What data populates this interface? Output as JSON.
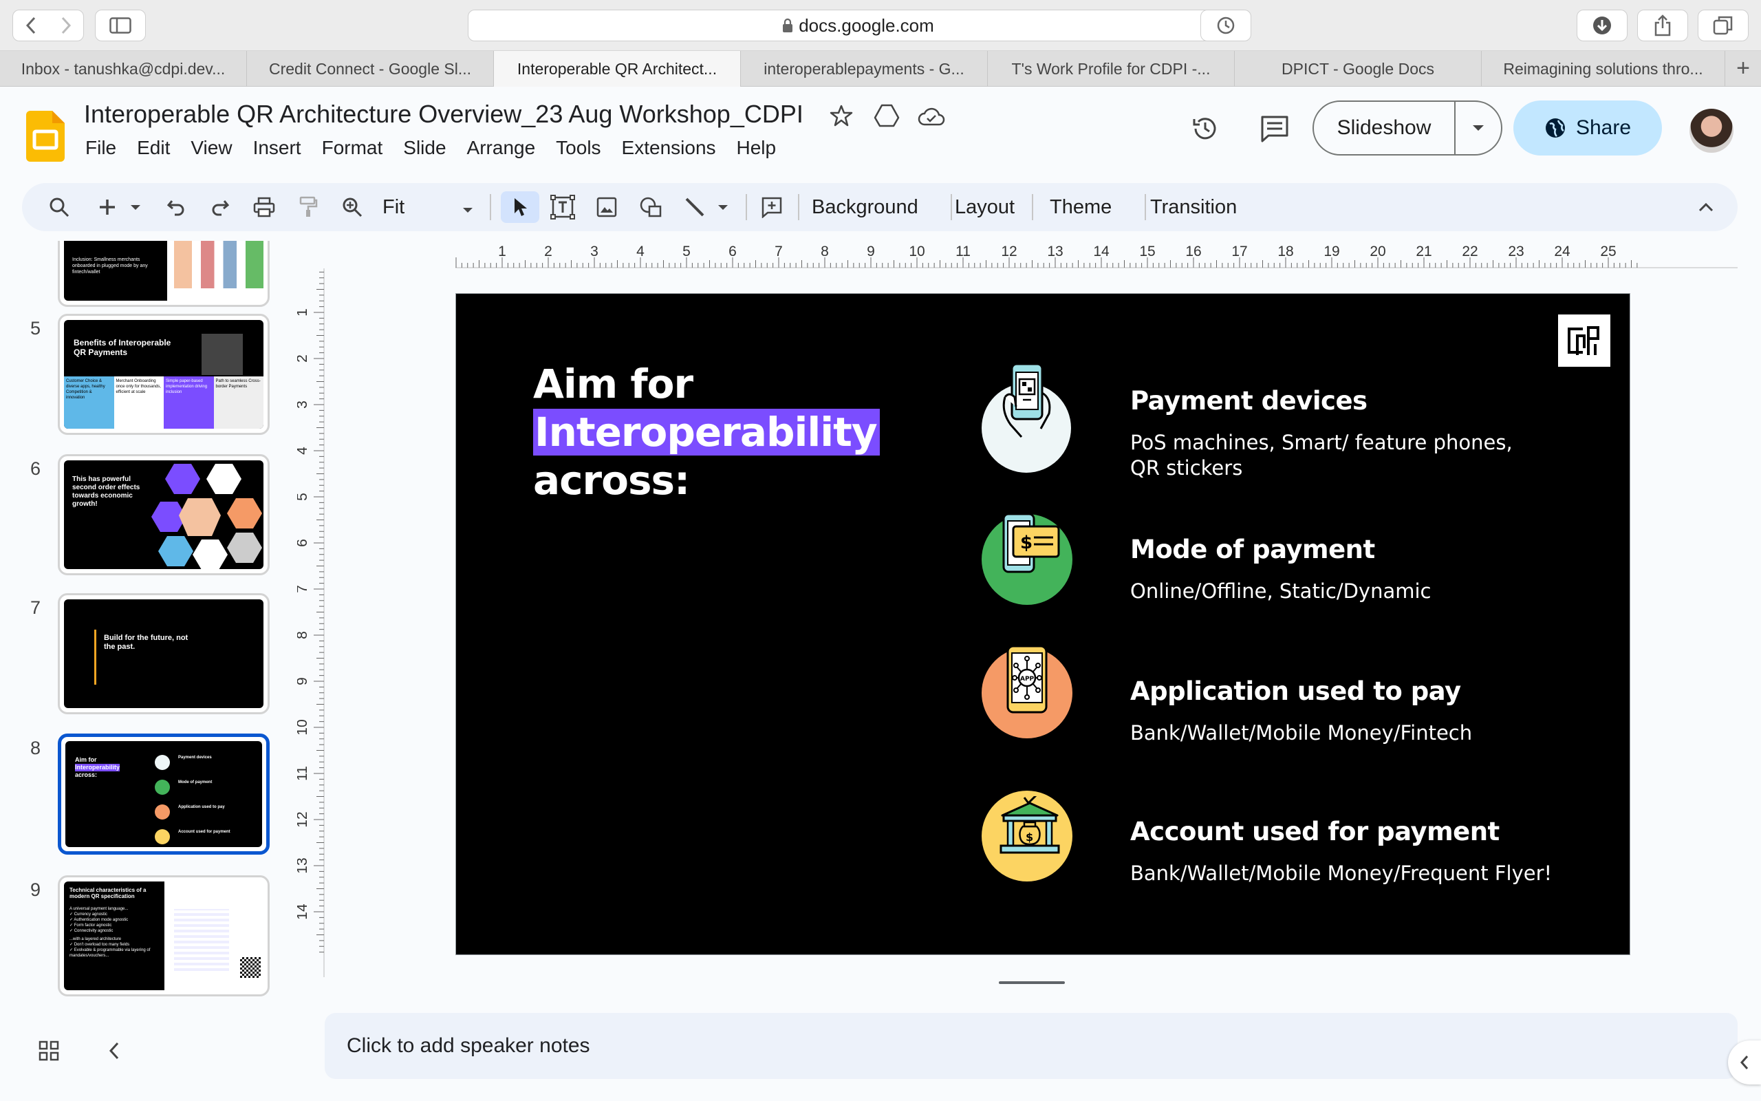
{
  "browser": {
    "url": "docs.google.com",
    "tabs": [
      {
        "label": "Inbox - tanushka@cdpi.dev..."
      },
      {
        "label": "Credit Connect - Google Sl..."
      },
      {
        "label": "Interoperable QR Architect..."
      },
      {
        "label": "interoperablepayments - G..."
      },
      {
        "label": "T's Work Profile for CDPI -..."
      },
      {
        "label": "DPICT - Google Docs"
      },
      {
        "label": "Reimagining solutions thro..."
      }
    ],
    "new_tab": "+"
  },
  "doc": {
    "title": "Interoperable QR Architecture Overview_23 Aug Workshop_CDPI",
    "menu": [
      "File",
      "Edit",
      "View",
      "Insert",
      "Format",
      "Slide",
      "Arrange",
      "Tools",
      "Extensions",
      "Help"
    ],
    "slideshow_label": "Slideshow",
    "share_label": "Share"
  },
  "toolbar": {
    "zoom": "Fit",
    "background": "Background",
    "layout": "Layout",
    "theme": "Theme",
    "transition": "Transition"
  },
  "filmstrip": {
    "numbers": [
      "5",
      "6",
      "7",
      "8",
      "9"
    ],
    "slide4": {
      "text": "Inclusion: Smallness merchants onboarded in plugged mode by any fintech/wallet"
    },
    "slide5": {
      "title": "Benefits of Interoperable QR Payments",
      "cols": [
        "Customer Choice & diverse apps, healthy Competition & innovation",
        "Merchant Onboarding once only for thousands, efficient at scale",
        "Simple paper-based implementation driving inclusion",
        "Path to seamless Cross-border Payments"
      ]
    },
    "slide6": {
      "title": "This has powerful second order effects towards economic growth!"
    },
    "slide7": {
      "text": "Build for the future, not the past."
    },
    "slide9": {
      "title": "Technical characteristics of a modern QR specification",
      "lines": [
        "A universal payment language...",
        "✓ Currency agnostic",
        "✓ Authentication mode agnostic",
        "✓ Form factor agnostic",
        "✓ Connectivity agnostic",
        "...with a layered architecture",
        "✓ Don't overload too many fields",
        "✓ Evolvable & programmable via layering of mandates/vouchers..."
      ]
    }
  },
  "ruler": {
    "h": [
      "1",
      "2",
      "3",
      "4",
      "5",
      "6",
      "7",
      "8",
      "9",
      "10",
      "11",
      "12",
      "13",
      "14",
      "15",
      "16",
      "17",
      "18",
      "19",
      "20",
      "21",
      "22",
      "23",
      "24",
      "25"
    ],
    "v": [
      "1",
      "2",
      "3",
      "4",
      "5",
      "6",
      "7",
      "8",
      "9",
      "10",
      "11",
      "12",
      "13",
      "14"
    ]
  },
  "slide": {
    "heading_line1": "Aim for",
    "heading_highlight": "Interoperability",
    "heading_line3": "across:",
    "logo": "CDPI",
    "rows": [
      {
        "title": "Payment devices",
        "sub": "PoS machines, Smart/ feature phones,",
        "sub2": "QR stickers",
        "icon": "phone-hand-icon",
        "color": "#eef6f7"
      },
      {
        "title": "Mode of payment",
        "sub": "Online/Offline, Static/Dynamic",
        "icon": "phone-card-icon",
        "color": "#43b35a"
      },
      {
        "title": "Application used to pay",
        "sub": "Bank/Wallet/Mobile Money/Fintech",
        "icon": "app-network-icon",
        "color": "#f59a66"
      },
      {
        "title": "Account used for payment",
        "sub": "Bank/Wallet/Mobile Money/Frequent Flyer!",
        "icon": "bank-icon",
        "color": "#fcd462"
      }
    ]
  },
  "notes": {
    "placeholder": "Click to add speaker notes"
  },
  "colors": {
    "accent": "#0b57d0",
    "highlight": "#7b4dff",
    "share_bg": "#c2e7ff"
  }
}
